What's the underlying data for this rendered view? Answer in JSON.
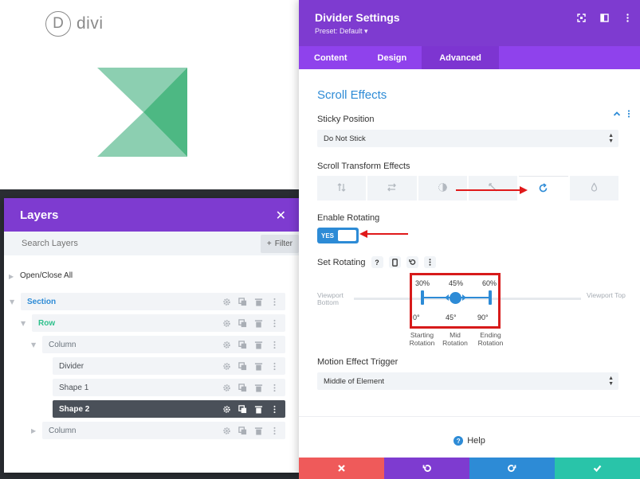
{
  "logo": {
    "mark": "D",
    "text": "divi"
  },
  "layers": {
    "title": "Layers",
    "close_icon": "close-icon",
    "search_placeholder": "Search Layers",
    "filter_label": "Filter",
    "open_close_label": "Open/Close All",
    "items": [
      {
        "label": "Section",
        "level": "section"
      },
      {
        "label": "Row",
        "level": "row"
      },
      {
        "label": "Column",
        "level": "column"
      },
      {
        "label": "Divider",
        "level": "module"
      },
      {
        "label": "Shape 1",
        "level": "module"
      },
      {
        "label": "Shape 2",
        "level": "module",
        "active": true
      },
      {
        "label": "Column",
        "level": "column"
      }
    ]
  },
  "settings": {
    "title": "Divider Settings",
    "preset": "Preset: Default ▾",
    "tabs": [
      {
        "label": "Content"
      },
      {
        "label": "Design"
      },
      {
        "label": "Advanced",
        "active": true
      }
    ],
    "section_title": "Scroll Effects",
    "sticky": {
      "label": "Sticky Position",
      "value": "Do Not Stick"
    },
    "scroll_transform": {
      "label": "Scroll Transform Effects",
      "effects": [
        "vertical-motion-icon",
        "horizontal-motion-icon",
        "fade-icon",
        "scale-icon",
        "rotate-icon",
        "blur-icon"
      ],
      "active_index": 4
    },
    "enable_rotating": {
      "label": "Enable Rotating",
      "value": "YES"
    },
    "set_rotating": {
      "label": "Set Rotating",
      "help": "?",
      "viewport_bottom": "Viewport Bottom",
      "viewport_top": "Viewport Top",
      "percents": [
        "30%",
        "45%",
        "60%"
      ],
      "degrees": [
        "0°",
        "45°",
        "90°"
      ],
      "captions": [
        "Starting Rotation",
        "Mid Rotation",
        "Ending Rotation"
      ]
    },
    "motion_trigger": {
      "label": "Motion Effect Trigger",
      "value": "Middle of Element"
    },
    "help_label": "Help",
    "colors": {
      "purple_header": "#7e3bd0",
      "purple_tabs": "#8f42ec",
      "blue": "#2d8bd6",
      "green": "#2ec08c",
      "cancel": "#ef5a5a",
      "undo": "#7e3bd0",
      "redo": "#2d8bd6",
      "save": "#29c4a9"
    }
  }
}
